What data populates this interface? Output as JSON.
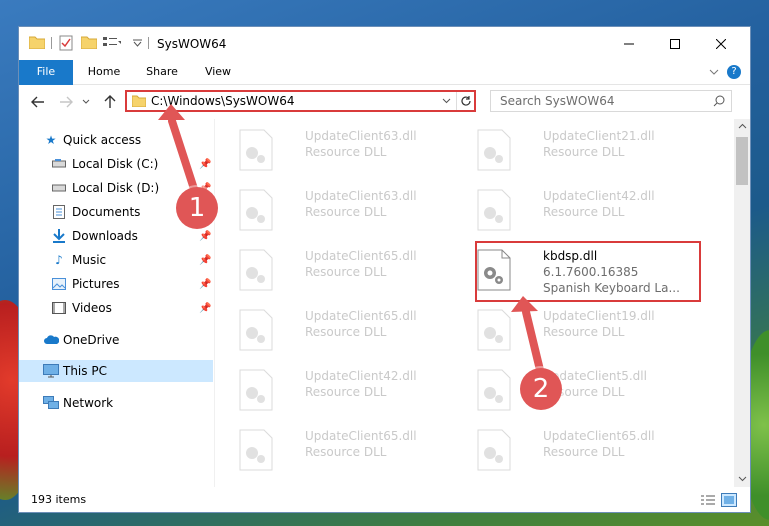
{
  "window": {
    "title": "SysWOW64",
    "minimize_icon": "minimize-icon",
    "maximize_icon": "maximize-icon",
    "close_icon": "close-icon"
  },
  "ribbon": {
    "tabs": [
      {
        "label": "File"
      },
      {
        "label": "Home"
      },
      {
        "label": "Share"
      },
      {
        "label": "View"
      }
    ]
  },
  "navbar": {
    "address": "C:\\Windows\\SysWOW64",
    "search_placeholder": "Search SysWOW64"
  },
  "sidebar": {
    "items": [
      {
        "label": "Quick access"
      },
      {
        "label": "Local Disk (C:)"
      },
      {
        "label": "Local Disk (D:)"
      },
      {
        "label": "Documents"
      },
      {
        "label": "Downloads"
      },
      {
        "label": "Music"
      },
      {
        "label": "Pictures"
      },
      {
        "label": "Videos"
      },
      {
        "label": "OneDrive"
      },
      {
        "label": "This PC"
      },
      {
        "label": "Network"
      }
    ]
  },
  "files": {
    "left": [
      {
        "name": "UpdateClient63.dll",
        "desc": "Resource DLL"
      },
      {
        "name": "UpdateClient63.dll",
        "desc": "Resource DLL"
      },
      {
        "name": "UpdateClient65.dll",
        "desc": "Resource DLL"
      },
      {
        "name": "UpdateClient65.dll",
        "desc": "Resource DLL"
      },
      {
        "name": "UpdateClient42.dll",
        "desc": "Resource DLL"
      },
      {
        "name": "UpdateClient65.dll",
        "desc": "Resource DLL"
      }
    ],
    "right": [
      {
        "name": "UpdateClient21.dll",
        "desc": "Resource DLL"
      },
      {
        "name": "UpdateClient42.dll",
        "desc": "Resource DLL"
      },
      {
        "name": "kbdsp.dll",
        "desc": "6.1.7600.16385",
        "desc2": "Spanish Keyboard La..."
      },
      {
        "name": "UpdateClient19.dll",
        "desc": "Resource DLL"
      },
      {
        "name": "UpdateClient5.dll",
        "desc": "Resource DLL"
      },
      {
        "name": "UpdateClient65.dll",
        "desc": "Resource DLL"
      }
    ]
  },
  "status": {
    "count": "193 items"
  },
  "annotations": {
    "step1": "1",
    "step2": "2"
  },
  "colors": {
    "accent": "#1979ca",
    "highlight": "#d93b3b",
    "selected": "#cce8ff"
  }
}
